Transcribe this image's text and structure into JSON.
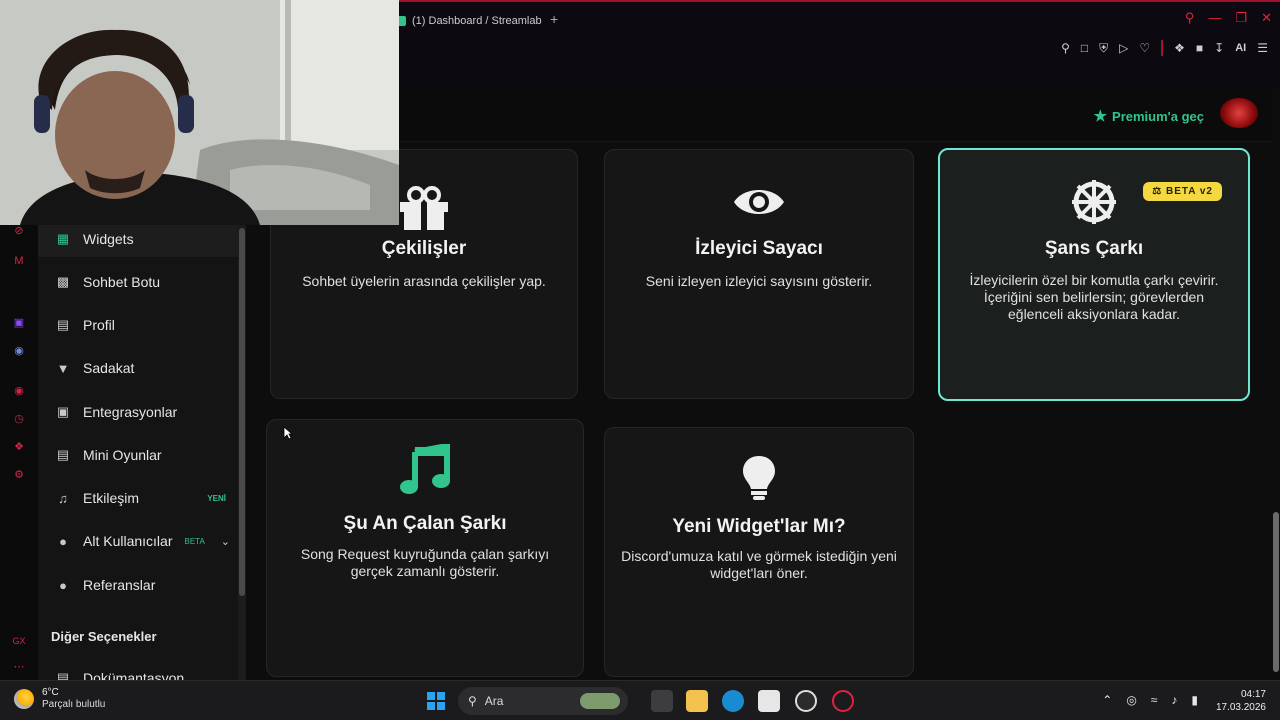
{
  "browser": {
    "tab_title": "(1) Dashboard / Streamlabs",
    "new_tab": "+",
    "ai_label": "AI"
  },
  "header": {
    "premium_label": "Premium'a geç"
  },
  "sidebar": {
    "items": [
      {
        "label": "Widgets",
        "icon": "grid-icon"
      },
      {
        "label": "Sohbet Botu",
        "icon": "robot-icon"
      },
      {
        "label": "Profil",
        "icon": "id-card-icon"
      },
      {
        "label": "Sadakat",
        "icon": "trophy-icon"
      },
      {
        "label": "Entegrasyonlar",
        "icon": "plug-icon"
      },
      {
        "label": "Mini Oyunlar",
        "icon": "gamepad-icon"
      },
      {
        "label": "Etkileşim",
        "icon": "music-note-icon",
        "badge": "YENİ"
      },
      {
        "label": "Alt Kullanıcılar",
        "icon": "users-icon",
        "badge": "BETA"
      },
      {
        "label": "Referanslar",
        "icon": "user-group-icon"
      }
    ],
    "section_title": "Diğer Seçenekler",
    "next_item": "Dokümantasyon"
  },
  "cards": [
    {
      "title": "Çekilişler",
      "desc": "Sohbet üyelerin arasında çekilişler yap.",
      "icon": "gift-icon"
    },
    {
      "title": "İzleyici Sayacı",
      "desc": "Seni izleyen izleyici sayısını gösterir.",
      "icon": "eye-icon"
    },
    {
      "title": "Şans Çarkı",
      "desc": "İzleyicilerin özel bir komutla çarkı çevirir. İçeriğini sen belirlersin; görevlerden eğlenceli aksiyonlara kadar.",
      "icon": "wheel-icon",
      "badge": "BETA v2"
    },
    {
      "title": "Şu An Çalan Şarkı",
      "desc": "Song Request kuyruğunda çalan şarkıyı gerçek zamanlı gösterir.",
      "icon": "music-icon"
    },
    {
      "title": "Yeni Widget'lar Mı?",
      "desc": "Discord'umuza katıl ve görmek istediğin yeni widget'ları öner.",
      "icon": "lightbulb-icon"
    }
  ],
  "taskbar": {
    "temp": "6°C",
    "condition": "Parçalı bulutlu",
    "search_label": "Ara",
    "time": "04:17",
    "date": "17.03.2026"
  },
  "colors": {
    "accent": "#31c48d",
    "browser_red": "#d5244b",
    "highlight_border": "#6ee7d5",
    "beta_yellow": "#f5d742"
  }
}
